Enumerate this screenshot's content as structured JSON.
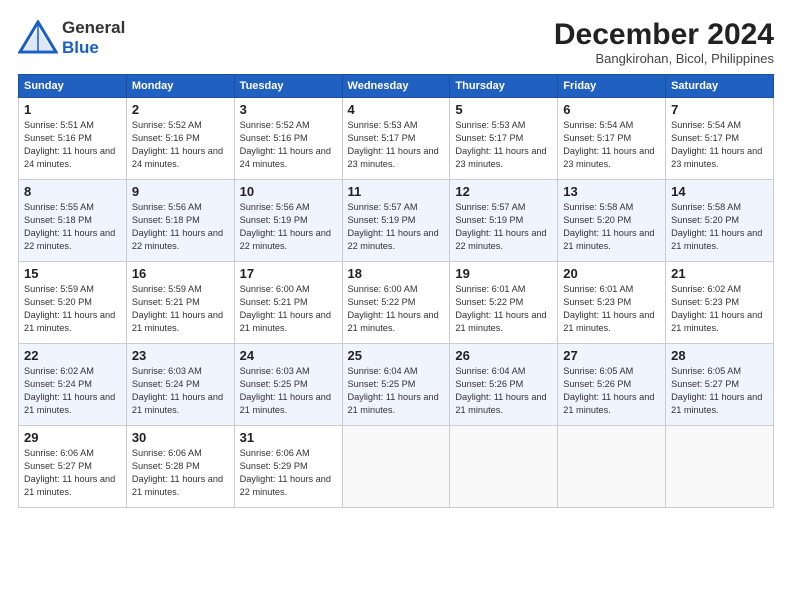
{
  "header": {
    "logo_general": "General",
    "logo_blue": "Blue",
    "month_title": "December 2024",
    "location": "Bangkirohan, Bicol, Philippines"
  },
  "days_of_week": [
    "Sunday",
    "Monday",
    "Tuesday",
    "Wednesday",
    "Thursday",
    "Friday",
    "Saturday"
  ],
  "weeks": [
    [
      {
        "day": "1",
        "sunrise": "Sunrise: 5:51 AM",
        "sunset": "Sunset: 5:16 PM",
        "daylight": "Daylight: 11 hours and 24 minutes."
      },
      {
        "day": "2",
        "sunrise": "Sunrise: 5:52 AM",
        "sunset": "Sunset: 5:16 PM",
        "daylight": "Daylight: 11 hours and 24 minutes."
      },
      {
        "day": "3",
        "sunrise": "Sunrise: 5:52 AM",
        "sunset": "Sunset: 5:16 PM",
        "daylight": "Daylight: 11 hours and 24 minutes."
      },
      {
        "day": "4",
        "sunrise": "Sunrise: 5:53 AM",
        "sunset": "Sunset: 5:17 PM",
        "daylight": "Daylight: 11 hours and 23 minutes."
      },
      {
        "day": "5",
        "sunrise": "Sunrise: 5:53 AM",
        "sunset": "Sunset: 5:17 PM",
        "daylight": "Daylight: 11 hours and 23 minutes."
      },
      {
        "day": "6",
        "sunrise": "Sunrise: 5:54 AM",
        "sunset": "Sunset: 5:17 PM",
        "daylight": "Daylight: 11 hours and 23 minutes."
      },
      {
        "day": "7",
        "sunrise": "Sunrise: 5:54 AM",
        "sunset": "Sunset: 5:17 PM",
        "daylight": "Daylight: 11 hours and 23 minutes."
      }
    ],
    [
      {
        "day": "8",
        "sunrise": "Sunrise: 5:55 AM",
        "sunset": "Sunset: 5:18 PM",
        "daylight": "Daylight: 11 hours and 22 minutes."
      },
      {
        "day": "9",
        "sunrise": "Sunrise: 5:56 AM",
        "sunset": "Sunset: 5:18 PM",
        "daylight": "Daylight: 11 hours and 22 minutes."
      },
      {
        "day": "10",
        "sunrise": "Sunrise: 5:56 AM",
        "sunset": "Sunset: 5:19 PM",
        "daylight": "Daylight: 11 hours and 22 minutes."
      },
      {
        "day": "11",
        "sunrise": "Sunrise: 5:57 AM",
        "sunset": "Sunset: 5:19 PM",
        "daylight": "Daylight: 11 hours and 22 minutes."
      },
      {
        "day": "12",
        "sunrise": "Sunrise: 5:57 AM",
        "sunset": "Sunset: 5:19 PM",
        "daylight": "Daylight: 11 hours and 22 minutes."
      },
      {
        "day": "13",
        "sunrise": "Sunrise: 5:58 AM",
        "sunset": "Sunset: 5:20 PM",
        "daylight": "Daylight: 11 hours and 21 minutes."
      },
      {
        "day": "14",
        "sunrise": "Sunrise: 5:58 AM",
        "sunset": "Sunset: 5:20 PM",
        "daylight": "Daylight: 11 hours and 21 minutes."
      }
    ],
    [
      {
        "day": "15",
        "sunrise": "Sunrise: 5:59 AM",
        "sunset": "Sunset: 5:20 PM",
        "daylight": "Daylight: 11 hours and 21 minutes."
      },
      {
        "day": "16",
        "sunrise": "Sunrise: 5:59 AM",
        "sunset": "Sunset: 5:21 PM",
        "daylight": "Daylight: 11 hours and 21 minutes."
      },
      {
        "day": "17",
        "sunrise": "Sunrise: 6:00 AM",
        "sunset": "Sunset: 5:21 PM",
        "daylight": "Daylight: 11 hours and 21 minutes."
      },
      {
        "day": "18",
        "sunrise": "Sunrise: 6:00 AM",
        "sunset": "Sunset: 5:22 PM",
        "daylight": "Daylight: 11 hours and 21 minutes."
      },
      {
        "day": "19",
        "sunrise": "Sunrise: 6:01 AM",
        "sunset": "Sunset: 5:22 PM",
        "daylight": "Daylight: 11 hours and 21 minutes."
      },
      {
        "day": "20",
        "sunrise": "Sunrise: 6:01 AM",
        "sunset": "Sunset: 5:23 PM",
        "daylight": "Daylight: 11 hours and 21 minutes."
      },
      {
        "day": "21",
        "sunrise": "Sunrise: 6:02 AM",
        "sunset": "Sunset: 5:23 PM",
        "daylight": "Daylight: 11 hours and 21 minutes."
      }
    ],
    [
      {
        "day": "22",
        "sunrise": "Sunrise: 6:02 AM",
        "sunset": "Sunset: 5:24 PM",
        "daylight": "Daylight: 11 hours and 21 minutes."
      },
      {
        "day": "23",
        "sunrise": "Sunrise: 6:03 AM",
        "sunset": "Sunset: 5:24 PM",
        "daylight": "Daylight: 11 hours and 21 minutes."
      },
      {
        "day": "24",
        "sunrise": "Sunrise: 6:03 AM",
        "sunset": "Sunset: 5:25 PM",
        "daylight": "Daylight: 11 hours and 21 minutes."
      },
      {
        "day": "25",
        "sunrise": "Sunrise: 6:04 AM",
        "sunset": "Sunset: 5:25 PM",
        "daylight": "Daylight: 11 hours and 21 minutes."
      },
      {
        "day": "26",
        "sunrise": "Sunrise: 6:04 AM",
        "sunset": "Sunset: 5:26 PM",
        "daylight": "Daylight: 11 hours and 21 minutes."
      },
      {
        "day": "27",
        "sunrise": "Sunrise: 6:05 AM",
        "sunset": "Sunset: 5:26 PM",
        "daylight": "Daylight: 11 hours and 21 minutes."
      },
      {
        "day": "28",
        "sunrise": "Sunrise: 6:05 AM",
        "sunset": "Sunset: 5:27 PM",
        "daylight": "Daylight: 11 hours and 21 minutes."
      }
    ],
    [
      {
        "day": "29",
        "sunrise": "Sunrise: 6:06 AM",
        "sunset": "Sunset: 5:27 PM",
        "daylight": "Daylight: 11 hours and 21 minutes."
      },
      {
        "day": "30",
        "sunrise": "Sunrise: 6:06 AM",
        "sunset": "Sunset: 5:28 PM",
        "daylight": "Daylight: 11 hours and 21 minutes."
      },
      {
        "day": "31",
        "sunrise": "Sunrise: 6:06 AM",
        "sunset": "Sunset: 5:29 PM",
        "daylight": "Daylight: 11 hours and 22 minutes."
      },
      null,
      null,
      null,
      null
    ]
  ]
}
